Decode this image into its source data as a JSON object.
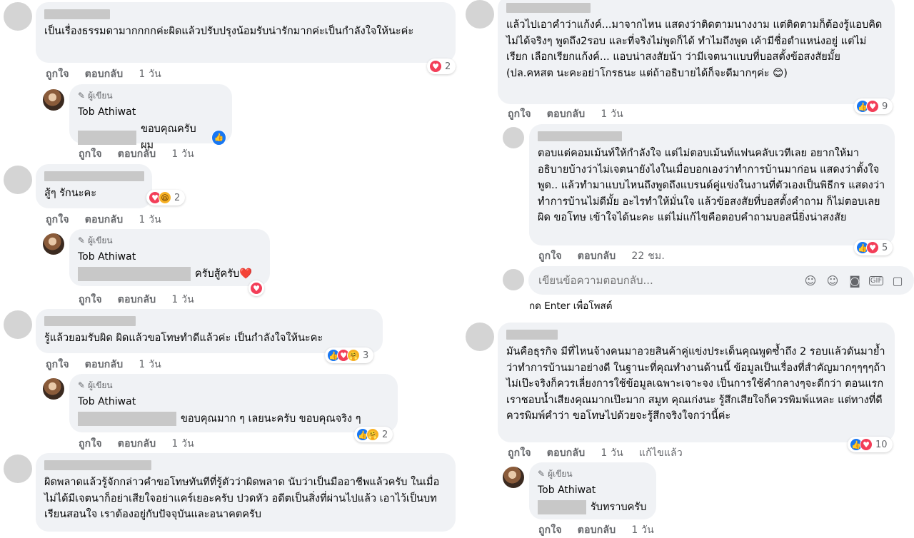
{
  "labels": {
    "like": "ถูกใจ",
    "reply": "ตอบกลับ",
    "author_badge": "ผู้เขียน",
    "edited": "แก้ไขแล้ว"
  },
  "colors": {
    "bubble": "#f0f2f5",
    "like": "#1877f2",
    "love": "#f33e58",
    "meta": "#65676b"
  },
  "left": {
    "c1": {
      "text": "เป็นเรื่องธรรมดามากกกกค่ะผิดแล้วปรับปรุงน้อมรับน่ารักมากค่ะเป็นกำลังใจให้นะค่ะ",
      "time": "1 วัน",
      "reactions": "2"
    },
    "r1": {
      "author": "Tob Athiwat",
      "text": "ขอบคุณครับผม",
      "time": "1 วัน"
    },
    "c2": {
      "text": "สู้ๆ รักนะคะ",
      "time": "1 วัน",
      "reactions": "2"
    },
    "r2": {
      "author": "Tob Athiwat",
      "text": "ครับสู้ครับ❤️",
      "time": "1 วัน"
    },
    "c3": {
      "text": "รู้แล้วยอมรับผิด ผิดแล้วขอโทษทำดีแล้วค่ะ เป็นกำลังใจให้นะคะ",
      "time": "1 วัน",
      "reactions": "3"
    },
    "r3": {
      "author": "Tob Athiwat",
      "text": "ขอบคุณมาก ๆ เลยนะครับ ขอบคุณจริง ๆ",
      "time": "1 วัน",
      "reactions": "2"
    },
    "c4": {
      "text": "ผิดพลาดแล้วรู้จักกล่าวคำขอโทษทันทีที่รู้ตัวว่าผิดพลาด นับว่าเป็นมืออาชีพแล้วครับ ในเมื่อไม่ได้มีเจตนาก็อย่าเสียใจอย่าแคร์เยอะครับ ปวดหัว อดีตเป็นสิ่งที่ผ่านไปแล้ว เอาไว้เป็นบทเรียนสอนใจ เราต้องอยู่กับปัจจุบันและอนาคตครับ"
    }
  },
  "right": {
    "c1": {
      "text": "แล้วไปเอาคำว่าแก้งค์...มาจากไหน แสดงว่าติดตามนางงาม แต่ติดตามก็ต้องรู้แอบคิดไม่ได้จริงๆ พูดถึง2รอบ และที่จริงไม่พูดก็ได้ ทำไมถึงพูด เค้ามีชื่อตำแหน่งอยู่ แต่ไม่เรียก เลือกเรียกแก้งค์... แอบน่าสงสัยน้า ว่ามีเจตนาแบบที่บอสตั้งข้อสงสัยมั้ย (ปล.คหสต นะคะอย่าโกรธนะ แต่ถ้าอธิบายได้ก็จะดีมากๆค่ะ 😊)",
      "time": "1 วัน",
      "reactions": "9"
    },
    "r1": {
      "text": "ตอบแต่คอมเม้นท์ให้กำลังใจ แต่ไม่ตอบเม้นท์แฟนคลับเวทีเลย อยากให้มาอธิบายบ้างว่าไม่เจตนายังไงในเมื่อบอกเองว่าทำการบ้านมาก่อน แสดงว่าตั้งใจพูด.. แล้วทำมาแบบไหนถึงพูดถึงแบรนด์คู่แข่งในงานที่ตัวเองเป็นพิธีกร แสดงว่าทำการบ้านไม่ดีมั้ย อะไรทำให้มั่นใจ แล้วข้อสงสัยที่บอสตั้งคำถาม ก็ไม่ตอบเลย ผิด ขอโทษ เข้าใจได้นะคะ แต่ไม่แก้ไขคือตอบคำถามบอสนี่ยิ่งน่าสงสัย",
      "time": "22 ชม.",
      "reactions": "5"
    },
    "input": {
      "placeholder": "เขียนข้อความตอบกลับ...",
      "hint": "กด Enter เพื่อโพสต์"
    },
    "c2": {
      "text": "มันคือธุรกิจ มีที่ไหนจ้างคนมาอวยสินค้าคู่แข่งประเด็นคุณพูดซ้ำถึง 2 รอบแล้วดันมาย้ำว่าทำการบ้านมาอย่างดี ในฐานะที่คุณทำงานด้านนี้ ข้อมูลเป็นเรื่องที่สำคัญมากๆๆๆๆถ้าไม่เป๊ะจริงก็ควรเลี่ยงการใช้ข้อมูลเฉพาะเจาะจง เป็นการใช้คำกลางๆจะดีกว่า ตอนแรกเราชอบน้ำเสียงคุณมากเป๊ะมาก สมูท คุณเก่งนะ รู้สึกเสียใจก็ควรพิมพ์แหละ แต่ทางที่ดี ควรพิมพ์คำว่า ขอโทษไปด้วยจะรู้สึกจริงใจกว่านี้ค่ะ",
      "time": "1 วัน",
      "reactions": "10"
    },
    "r2": {
      "author": "Tob Athiwat",
      "text": "รับทราบครับ",
      "time": "1 วัน"
    }
  }
}
